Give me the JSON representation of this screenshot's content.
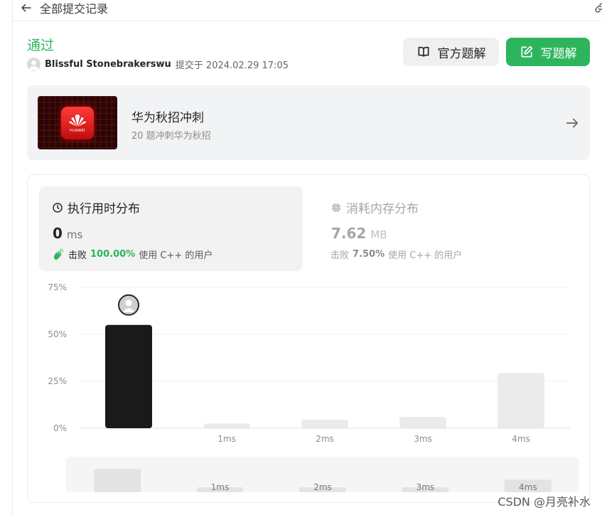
{
  "nav": {
    "back_label": "全部提交记录"
  },
  "submission": {
    "status": "通过",
    "username": "Blissful Stonebrakerswu",
    "submitted_text": "提交于 2024.02.29 17:05"
  },
  "actions": {
    "official_label": "官方题解",
    "write_label": "写题解"
  },
  "promo": {
    "title": "华为秋招冲刺",
    "subtitle": "20 题冲刺华为秋招",
    "image_text": "HUAWEI"
  },
  "runtime": {
    "title": "执行用时分布",
    "value": "0",
    "unit": "ms",
    "beat_prefix": "击败",
    "beat_pct": "100.00%",
    "beat_suffix": "使用 C++ 的用户"
  },
  "memory": {
    "title": "消耗内存分布",
    "value": "7.62",
    "unit": "MB",
    "beat_prefix": "击败",
    "beat_pct": "7.50%",
    "beat_suffix": "使用 C++ 的用户"
  },
  "colors": {
    "accent": "#2db55d",
    "selected_bar": "#1a1a1a",
    "bar": "#ebebeb"
  },
  "chart_data": {
    "type": "bar",
    "categories": [
      "0ms",
      "1ms",
      "2ms",
      "3ms",
      "4ms"
    ],
    "category_labels": [
      "",
      "1ms",
      "2ms",
      "3ms",
      "4ms"
    ],
    "values": [
      55,
      2.5,
      4.5,
      6,
      29.5
    ],
    "selected_index": 0,
    "yticks": [
      "0%",
      "25%",
      "50%",
      "75%"
    ],
    "ytick_values": [
      0,
      25,
      50,
      75
    ],
    "ylim": [
      0,
      75
    ],
    "grid": true,
    "overview_labels": [
      "",
      "1ms",
      "2ms",
      "3ms",
      "4ms"
    ]
  },
  "watermark": "CSDN @月亮补水"
}
